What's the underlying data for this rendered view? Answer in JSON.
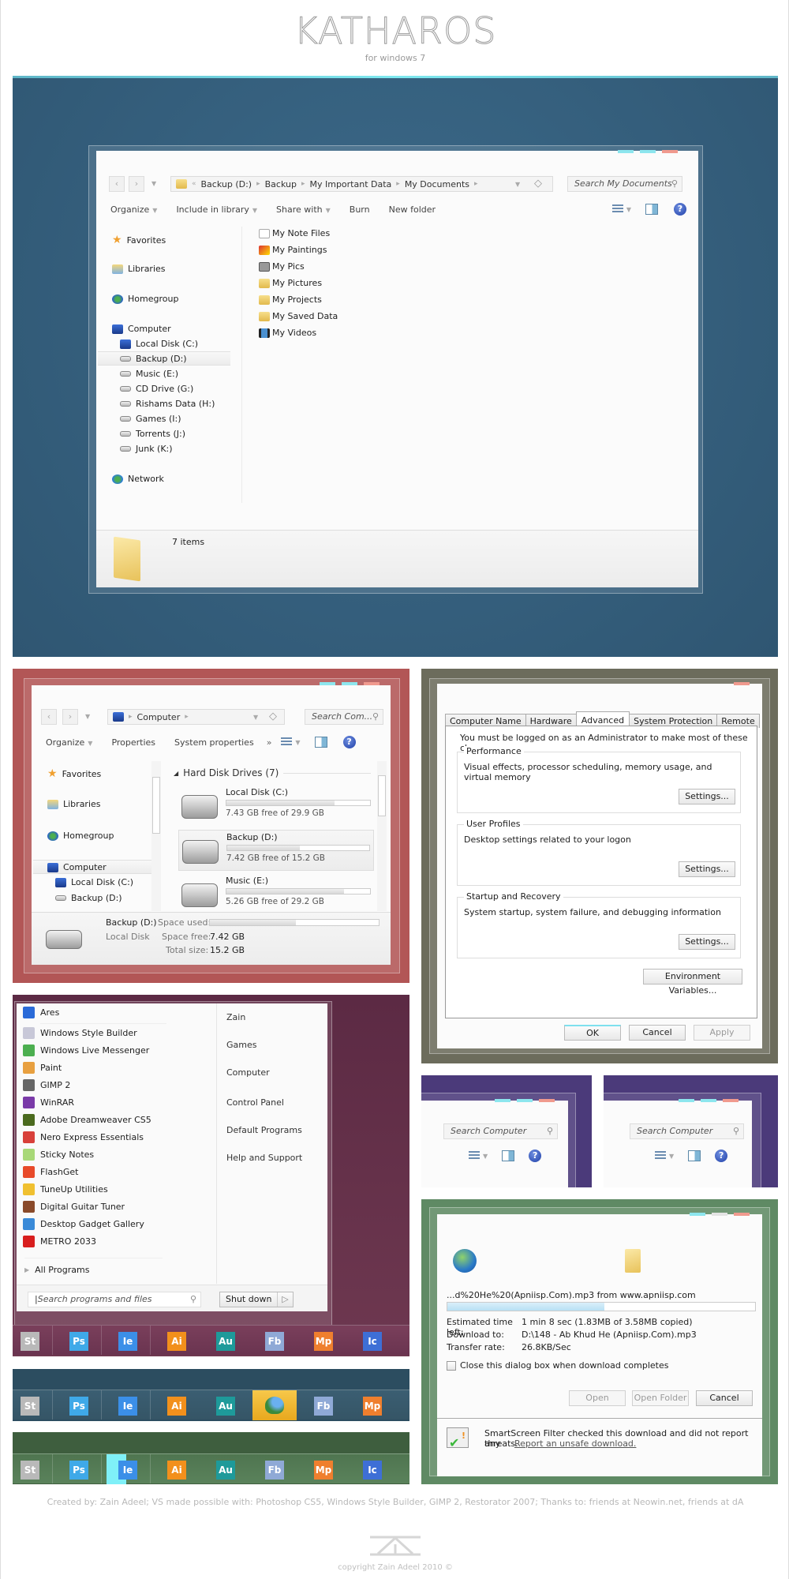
{
  "header": {
    "title": "KATHAROS",
    "subtitle": "for windows 7"
  },
  "explorer_main": {
    "address": [
      "Backup (D:)",
      "Backup",
      "My Important Data",
      "My Documents"
    ],
    "search_placeholder": "Search My Documents",
    "toolbar": [
      "Organize",
      "Include in library",
      "Share with",
      "Burn",
      "New folder"
    ],
    "nav": {
      "favorites": "Favorites",
      "libraries": "Libraries",
      "homegroup": "Homegroup",
      "computer": "Computer",
      "drives": [
        "Local Disk (C:)",
        "Backup (D:)",
        "Music (E:)",
        "CD Drive (G:)",
        "Rishams Data (H:)",
        "Games (I:)",
        "Torrents (J:)",
        "Junk (K:)"
      ],
      "selected_drive": "Backup (D:)",
      "network": "Network"
    },
    "files": [
      "My Note Files",
      "My Paintings",
      "My Pics",
      "My Pictures",
      "My Projects",
      "My Saved Data",
      "My Videos"
    ],
    "status": "7 items"
  },
  "explorer_computer": {
    "address": "Computer",
    "search_placeholder": "Search Com...",
    "toolbar": [
      "Organize",
      "Properties",
      "System properties"
    ],
    "more": "»",
    "nav": [
      "Favorites",
      "Libraries",
      "Homegroup",
      "Computer",
      "Local Disk (C:)",
      "Backup (D:)"
    ],
    "group_header": "Hard Disk Drives (7)",
    "drives": [
      {
        "name": "Local Disk (C:)",
        "free": "7.43 GB free of 29.9 GB",
        "used_fraction": 0.75
      },
      {
        "name": "Backup (D:)",
        "free": "7.42 GB free of 15.2 GB",
        "used_fraction": 0.51
      },
      {
        "name": "Music (E:)",
        "free": "5.26 GB free of 29.2 GB",
        "used_fraction": 0.82
      }
    ],
    "details": {
      "name": "Backup (D:)",
      "type": "Local Disk",
      "space_used_label": "Space used:",
      "space_used_fraction": 0.51,
      "space_free_label": "Space free:",
      "space_free": "7.42 GB",
      "total_label": "Total size:",
      "total": "15.2 GB"
    }
  },
  "system_properties": {
    "tabs": [
      "Computer Name",
      "Hardware",
      "Advanced",
      "System Protection",
      "Remote"
    ],
    "active_tab": "Advanced",
    "admin_note": "You must be logged on as an Administrator to make most of these changes.",
    "groups": [
      {
        "label": "Performance",
        "desc": "Visual effects, processor scheduling, memory usage, and virtual memory",
        "button": "Settings..."
      },
      {
        "label": "User Profiles",
        "desc": "Desktop settings related to your logon",
        "button": "Settings..."
      },
      {
        "label": "Startup and Recovery",
        "desc": "System startup, system failure, and debugging information",
        "button": "Settings..."
      }
    ],
    "env_button": "Environment Variables...",
    "ok": "OK",
    "cancel": "Cancel",
    "apply": "Apply"
  },
  "start_menu": {
    "programs": [
      "Ares",
      "Windows Style Builder",
      "Windows Live Messenger",
      "Paint",
      "GIMP 2",
      "WinRAR",
      "Adobe Dreamweaver CS5",
      "Nero Express Essentials",
      "Sticky Notes",
      "FlashGet",
      "TuneUp Utilities",
      "Digital Guitar Tuner",
      "Desktop Gadget Gallery",
      "METRO 2033"
    ],
    "all_programs": "All Programs",
    "search_placeholder": "Search programs and files",
    "right": [
      "Zain",
      "Games",
      "Computer",
      "Control Panel",
      "Default Programs",
      "Help and Support"
    ],
    "shutdown": "Shut down"
  },
  "mini_explorers": [
    {
      "search_placeholder": "Search Computer"
    },
    {
      "search_placeholder": "Search Computer"
    }
  ],
  "taskbars": [
    {
      "icons": [
        "St",
        "Ps",
        "Ie",
        "Ai",
        "Au",
        "Fb",
        "Mp",
        "Ic"
      ]
    },
    {
      "icons": [
        "St",
        "Ps",
        "Ie",
        "Ai",
        "Au",
        "messenger-icon",
        "Fb",
        "Mp"
      ]
    },
    {
      "icons": [
        "St",
        "Ps",
        "Ie",
        "Ai",
        "Au",
        "Fb",
        "Mp",
        "Ic"
      ]
    }
  ],
  "icon_colors": {
    "St": "#b9b9b9",
    "Ps": "#3fa9e8",
    "Ie": "#3b8fe8",
    "Ai": "#f2901c",
    "Au": "#1e9a9a",
    "Fb": "#8fa9d6",
    "Mp": "#ef7f2e",
    "Ic": "#3e6fd6"
  },
  "download": {
    "file_line": "...d%20He%20(Apniisp.Com).mp3 from www.apniisp.com",
    "progress_fraction": 0.51,
    "rows": [
      {
        "k": "Estimated time left:",
        "v": "1 min 8 sec (1.83MB of 3.58MB copied)"
      },
      {
        "k": "Download to:",
        "v": "D:\\148 - Ab Khud He (Apniisp.Com).mp3"
      },
      {
        "k": "Transfer rate:",
        "v": "26.8KB/Sec"
      }
    ],
    "checkbox_label": "Close this dialog box when download completes",
    "open": "Open",
    "open_folder": "Open Folder",
    "cancel": "Cancel",
    "smartscreen": "SmartScreen Filter checked this download and did not report any",
    "smartscreen_2": "threats.",
    "report_link": "Report an unsafe download."
  },
  "footer": {
    "credit": "Created by: Zain Adeel; VS made possible with: Photoshop CS5, Windows Style Builder, GIMP 2, Restorator 2007; Thanks to: friends at Neowin.net, friends at dA",
    "copyright": "copyright Zain Adeel 2010 ©"
  },
  "colors": {
    "blue_bg": "#35607f",
    "red_bg": "#b25656",
    "olive_bg": "#6c6c5c",
    "plum_bg": "#6c3450",
    "purple_bg": "#4b3a7a",
    "green_bg": "#5f8a64",
    "accent_cyan": "#8de6ee",
    "close_red": "#f09a8e"
  }
}
